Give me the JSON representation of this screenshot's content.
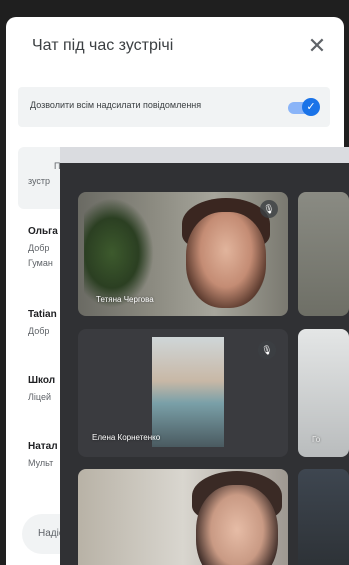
{
  "chat": {
    "title": "Чат під час зустрічі",
    "close_icon": "close-icon",
    "permission_label": "Дозволити всім надсилати повідомлення",
    "permission_enabled": true,
    "notice_line1": "По",
    "notice_line2": "зустр",
    "messages": [
      {
        "sender": "Ольга",
        "line1": "Добр",
        "line2": "Гуман"
      },
      {
        "sender": "Tatian",
        "line1": "Добр",
        "line2": ""
      },
      {
        "sender": "Школ",
        "line1": "Ліцей",
        "line2": ""
      },
      {
        "sender": "Натал",
        "line1": "Мульт",
        "line2": ""
      }
    ],
    "input_placeholder": "Надіс"
  },
  "video": {
    "tiles": [
      {
        "name": "Тетяна Чергова",
        "mic": "mic-off-icon"
      },
      {
        "name": "",
        "mic": ""
      },
      {
        "name": "Елена Корнетенко",
        "mic": "mic-off-icon"
      },
      {
        "name": "Го",
        "mic": ""
      },
      {
        "name": "",
        "mic": ""
      },
      {
        "name": "",
        "mic": ""
      }
    ]
  }
}
